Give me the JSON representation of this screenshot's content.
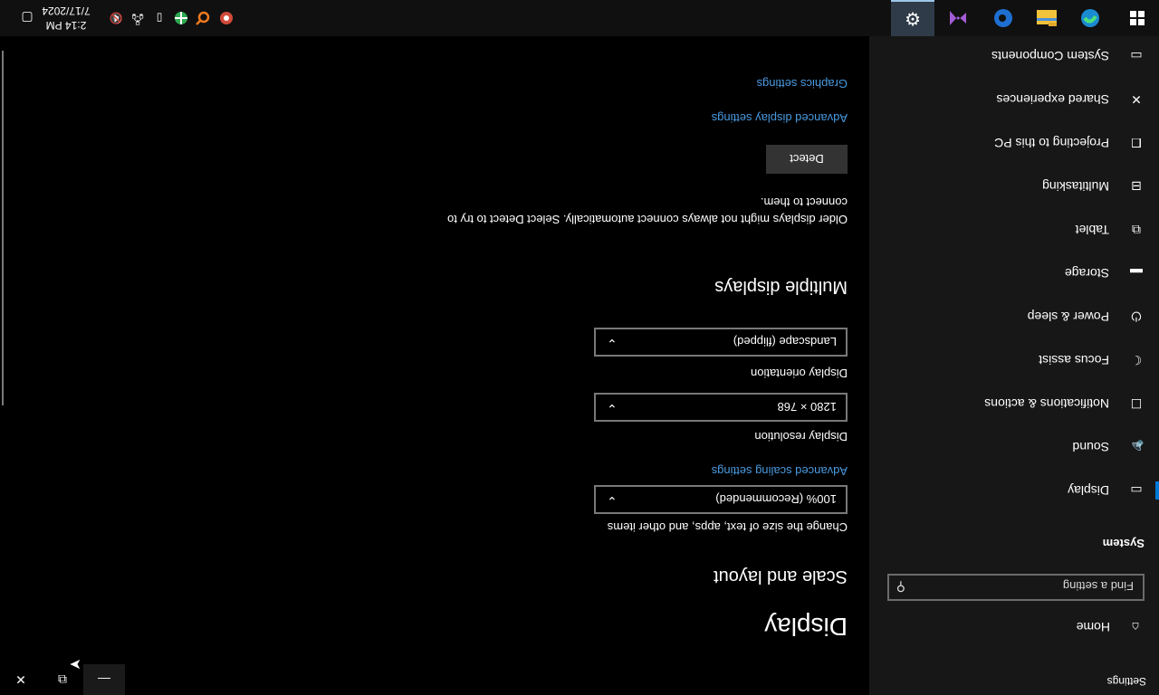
{
  "window": {
    "title": "Settings",
    "min_glyph": "—",
    "max_glyph": "⧉",
    "close_glyph": "✕"
  },
  "nav": {
    "home_label": "Home",
    "search_placeholder": "Find a setting",
    "section": "System",
    "items": [
      {
        "label": "Display",
        "icon": "monitor-icon"
      },
      {
        "label": "Sound",
        "icon": "speaker-icon"
      },
      {
        "label": "Notifications & actions",
        "icon": "notification-icon"
      },
      {
        "label": "Focus assist",
        "icon": "moon-icon"
      },
      {
        "label": "Power & sleep",
        "icon": "power-icon"
      },
      {
        "label": "Storage",
        "icon": "storage-icon"
      },
      {
        "label": "Tablet",
        "icon": "tablet-icon"
      },
      {
        "label": "Multitasking",
        "icon": "multitasking-icon"
      },
      {
        "label": "Projecting to this PC",
        "icon": "projecting-icon"
      },
      {
        "label": "Shared experiences",
        "icon": "shared-icon"
      },
      {
        "label": "System Components",
        "icon": "components-icon"
      }
    ]
  },
  "main": {
    "title": "Display",
    "scale_heading": "Scale and layout",
    "scale_label": "Change the size of text, apps, and other items",
    "scale_value": "100% (Recommended)",
    "advanced_scaling_link": "Advanced scaling settings",
    "resolution_label": "Display resolution",
    "resolution_value": "1280 × 768",
    "orientation_label": "Display orientation",
    "orientation_value": "Landscape (flipped)",
    "multiple_heading": "Multiple displays",
    "multiple_desc": "Older displays might not always connect automatically. Select Detect to try to connect to them.",
    "detect_label": "Detect",
    "advanced_display_link": "Advanced display settings",
    "graphics_link": "Graphics settings"
  },
  "taskbar": {
    "time": "2:14 PM",
    "date": "7/17/2024",
    "active_app": "Settings"
  },
  "colors": {
    "accent": "#0078d7",
    "link": "#4a9ae0",
    "nav_bg": "#171717",
    "content_bg": "#000000"
  }
}
